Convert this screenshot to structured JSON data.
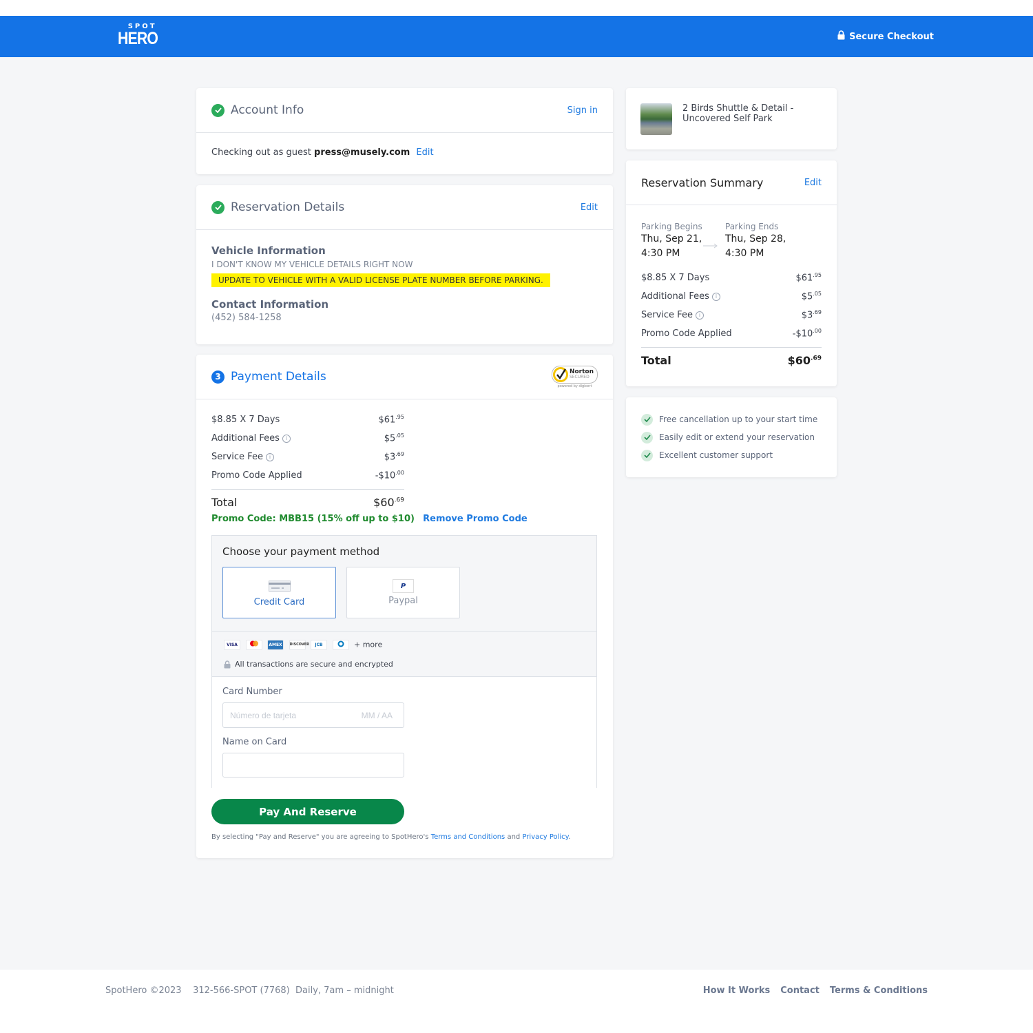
{
  "header": {
    "logo_top": "SPOT",
    "logo_bottom": "HERO",
    "secure_label": "Secure Checkout",
    "secure_icon": "lock-icon",
    "brand_color": "#1473e6"
  },
  "account": {
    "title": "Account Info",
    "sign_in": "Sign in",
    "guest_prefix": "Checking out as guest",
    "email": "press@musely.com",
    "edit": "Edit"
  },
  "reservation_details": {
    "title": "Reservation Details",
    "edit": "Edit",
    "vehicle_title": "Vehicle Information",
    "vehicle_value": "I DON'T KNOW MY VEHICLE DETAILS RIGHT NOW",
    "vehicle_warning": "UPDATE TO VEHICLE WITH A VALID LICENSE PLATE NUMBER BEFORE PARKING.",
    "contact_title": "Contact Information",
    "contact_phone": "(452) 584-1258"
  },
  "payment": {
    "step": "3",
    "title": "Payment Details",
    "norton_label": "Norton",
    "norton_sub": "SECURED",
    "norton_powered": "powered by digicert",
    "lines": [
      {
        "label": "$8.85 X 7 Days",
        "dollars": "$61",
        "cents": ".95",
        "info": false
      },
      {
        "label": "Additional Fees",
        "dollars": "$5",
        "cents": ".05",
        "info": true
      },
      {
        "label": "Service Fee",
        "dollars": "$3",
        "cents": ".69",
        "info": true
      },
      {
        "label": "Promo Code Applied",
        "dollars": "-$10",
        "cents": ".00",
        "info": false
      }
    ],
    "total_label": "Total",
    "total_dollars": "$60",
    "total_cents": ".69",
    "promo_text": "Promo Code: MBB15 (15% off up to $10)",
    "remove_promo": "Remove Promo Code",
    "choose_method": "Choose your payment method",
    "methods": [
      {
        "label": "Credit Card",
        "icon": "credit-card-icon",
        "selected": true
      },
      {
        "label": "Paypal",
        "icon": "paypal-icon",
        "selected": false
      }
    ],
    "card_brands": [
      "VISA",
      "Mastercard",
      "AMEX",
      "DISCOVER",
      "JCB",
      "Diners"
    ],
    "more": "+ more",
    "secure_note": "All transactions are secure and encrypted",
    "card_number_label": "Card Number",
    "card_number_placeholder": "Número de tarjeta",
    "expiry_placeholder": "MM / AA",
    "name_label": "Name on Card",
    "name_value": "",
    "pay_button": "Pay And Reserve",
    "terms_prefix": "By selecting \"Pay and Reserve\" you are agreeing to SpotHero's",
    "terms_link": "Terms and Conditions",
    "terms_and": "and",
    "privacy_link": "Privacy Policy",
    "pay_color": "#08874a"
  },
  "facility": {
    "name_line1": "2 Birds Shuttle & Detail -",
    "name_line2": "Uncovered Self Park"
  },
  "summary": {
    "title": "Reservation Summary",
    "edit": "Edit",
    "begins_label": "Parking Begins",
    "begins_date": "Thu, Sep 21,",
    "begins_time": "4:30 PM",
    "ends_label": "Parking Ends",
    "ends_date": "Thu, Sep 28,",
    "ends_time": "4:30 PM",
    "lines": [
      {
        "label": "$8.85 X 7 Days",
        "dollars": "$61",
        "cents": ".95",
        "info": false
      },
      {
        "label": "Additional Fees",
        "dollars": "$5",
        "cents": ".05",
        "info": true
      },
      {
        "label": "Service Fee",
        "dollars": "$3",
        "cents": ".69",
        "info": true
      },
      {
        "label": "Promo Code Applied",
        "dollars": "-$10",
        "cents": ".00",
        "info": false
      }
    ],
    "total_label": "Total",
    "total_dollars": "$60",
    "total_cents": ".69"
  },
  "benefits": [
    "Free cancellation up to your start time",
    "Easily edit or extend your reservation",
    "Excellent customer support"
  ],
  "footer": {
    "copyright": "SpotHero ©2023",
    "phone": "312-566-SPOT (7768)",
    "hours": "Daily, 7am – midnight",
    "links": [
      "How It Works",
      "Contact",
      "Terms & Conditions"
    ]
  }
}
